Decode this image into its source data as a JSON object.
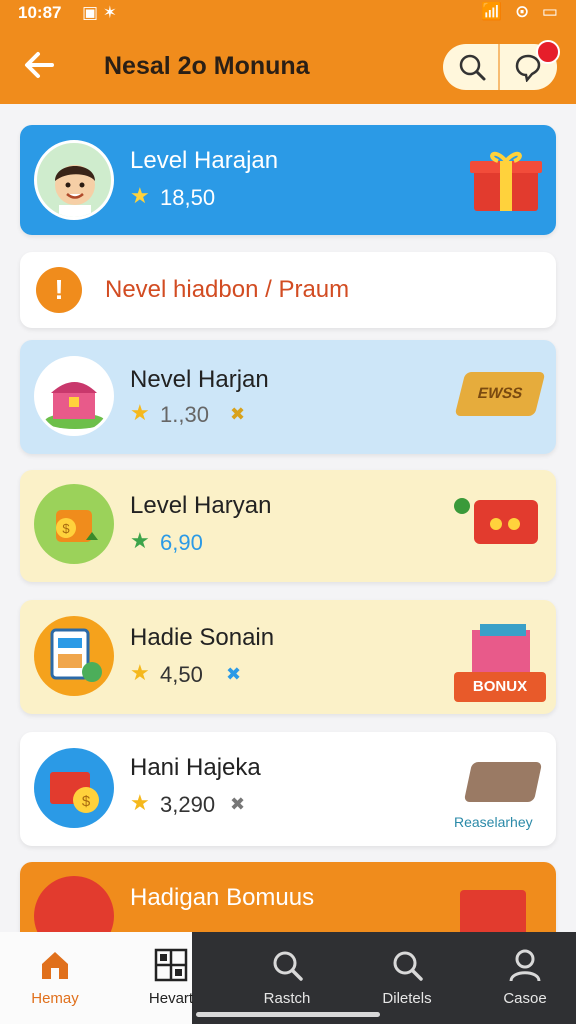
{
  "status": {
    "time": "10:87",
    "icons": "▣ ✶",
    "right_icons": "📶 ⊙ ▭"
  },
  "header": {
    "title": "Nesal 2o Monuna",
    "back_icon": "arrow-left-icon",
    "search_icon": "search-icon",
    "chat_icon": "chat-icon"
  },
  "cards": [
    {
      "title": "Level Harajan",
      "value": "18,50",
      "x": ""
    },
    {
      "title": "Nevel hiadbon / Praum"
    },
    {
      "title": "Nevel Harjan",
      "value": "1.,30",
      "x": "✖"
    },
    {
      "title": "Level Haryan",
      "value": "6,90",
      "x": ""
    },
    {
      "title": "Hadie Sonain",
      "value": "4,50",
      "x": "✖"
    },
    {
      "title": "Hani Hajeka",
      "value": "3,290",
      "x": "✖"
    },
    {
      "title": "Hadigan Bomuus",
      "value": "",
      "x": ""
    }
  ],
  "badges": {
    "crate_label": "EWSS",
    "bonus_label": "BONUX",
    "ticket_label": "Reaselarhey"
  },
  "nav": {
    "items": [
      {
        "label": "Hemay"
      },
      {
        "label": "Hevart"
      },
      {
        "label": "Rastch"
      },
      {
        "label": "Diletels"
      },
      {
        "label": "Casoe"
      }
    ]
  },
  "colors": {
    "primary": "#f08c1c",
    "blue_card": "#2b9ae6",
    "light_blue_card": "#cde6f8",
    "cream_card": "#fbf1c8",
    "nav_dark": "#2f3033"
  }
}
